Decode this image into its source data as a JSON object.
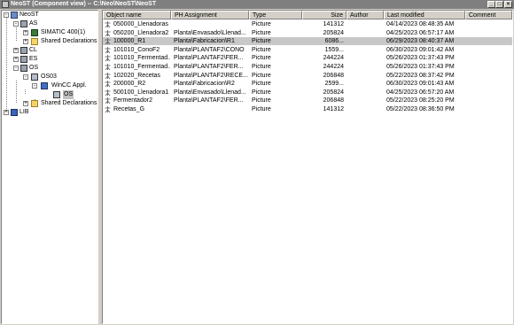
{
  "window": {
    "title": "NeoST (Component view) -- C:\\Neo\\NeoST\\NeoST",
    "buttons": {
      "minimize": "_",
      "maximize": "□",
      "close": "×"
    }
  },
  "tree": {
    "nodes": [
      {
        "label": "NeoST",
        "icon": "project-icon",
        "expander": "-"
      },
      {
        "label": "AS",
        "icon": "station-icon",
        "expander": "-"
      },
      {
        "label": "SIMATIC 400(1)",
        "icon": "plc-icon",
        "expander": "+"
      },
      {
        "label": "Shared Declarations",
        "icon": "folder-icon",
        "expander": "+"
      },
      {
        "label": "CL",
        "icon": "station-icon",
        "expander": "+"
      },
      {
        "label": "ES",
        "icon": "station-icon",
        "expander": "+"
      },
      {
        "label": "OS",
        "icon": "station-icon",
        "expander": "-"
      },
      {
        "label": "OS03",
        "icon": "pc-icon",
        "expander": "-"
      },
      {
        "label": "WinCC Appl.",
        "icon": "wincc-icon",
        "expander": "-"
      },
      {
        "label": "OS",
        "icon": "os-icon",
        "expander": ""
      },
      {
        "label": "Shared Declarations",
        "icon": "folder-icon",
        "expander": "+"
      },
      {
        "label": "LIB",
        "icon": "library-icon",
        "expander": "+"
      }
    ]
  },
  "list": {
    "columns": {
      "object_name": "Object name",
      "ph_assignment": "PH Assignment",
      "type": "Type",
      "size": "Size",
      "author": "Author",
      "last_modified": "Last modified",
      "comment": "Comment"
    },
    "rows": [
      {
        "name": "050000_Llenadoras",
        "ph": "",
        "type": "Picture",
        "size": "141312",
        "author": "",
        "modified": "04/14/2023 08:48:35 AM",
        "comment": ""
      },
      {
        "name": "050200_Llenadora2",
        "ph": "Planta\\Envasado\\Llenad...",
        "type": "Picture",
        "size": "205824",
        "author": "",
        "modified": "04/25/2023 06:57:17 AM",
        "comment": ""
      },
      {
        "name": "100000_R1",
        "ph": "Planta\\Fabricacion\\R1",
        "type": "Picture",
        "size": "6086...",
        "author": "",
        "modified": "06/29/2023 08:40:37 AM",
        "comment": ""
      },
      {
        "name": "101010_ConoF2",
        "ph": "Planta\\PLANTAF2\\CONO",
        "type": "Picture",
        "size": "1559...",
        "author": "",
        "modified": "06/30/2023 09:01:42 AM",
        "comment": ""
      },
      {
        "name": "101010_Fermentad...",
        "ph": "Planta\\PLANTAF2\\FER...",
        "type": "Picture",
        "size": "244224",
        "author": "",
        "modified": "05/26/2023 01:37:43 PM",
        "comment": ""
      },
      {
        "name": "101010_Fermentad...",
        "ph": "Planta\\PLANTAF2\\FER...",
        "type": "Picture",
        "size": "244224",
        "author": "",
        "modified": "05/26/2023 01:37:43 PM",
        "comment": ""
      },
      {
        "name": "102020_Recetas",
        "ph": "Planta\\PLANTAF2\\RECE...",
        "type": "Picture",
        "size": "206848",
        "author": "",
        "modified": "05/22/2023 08:37:42 PM",
        "comment": ""
      },
      {
        "name": "200000_R2",
        "ph": "Planta\\Fabricacion\\R2",
        "type": "Picture",
        "size": "2599...",
        "author": "",
        "modified": "06/30/2023 09:01:43 AM",
        "comment": ""
      },
      {
        "name": "500100_Llenadora1",
        "ph": "Planta\\Envasado\\Llenad...",
        "type": "Picture",
        "size": "205824",
        "author": "",
        "modified": "04/25/2023 06:57:20 AM",
        "comment": ""
      },
      {
        "name": "Fermentador2",
        "ph": "Planta\\PLANTAF2\\FER...",
        "type": "Picture",
        "size": "206848",
        "author": "",
        "modified": "05/22/2023 08:25:20 PM",
        "comment": ""
      },
      {
        "name": "Recetas_G",
        "ph": "",
        "type": "Picture",
        "size": "141312",
        "author": "",
        "modified": "05/22/2023 08:36:50 PM",
        "comment": ""
      }
    ]
  },
  "colors": {
    "title_bar": "#7f7f7f",
    "selected_row": "#c8c8c8",
    "chrome": "#d4d0c8"
  }
}
